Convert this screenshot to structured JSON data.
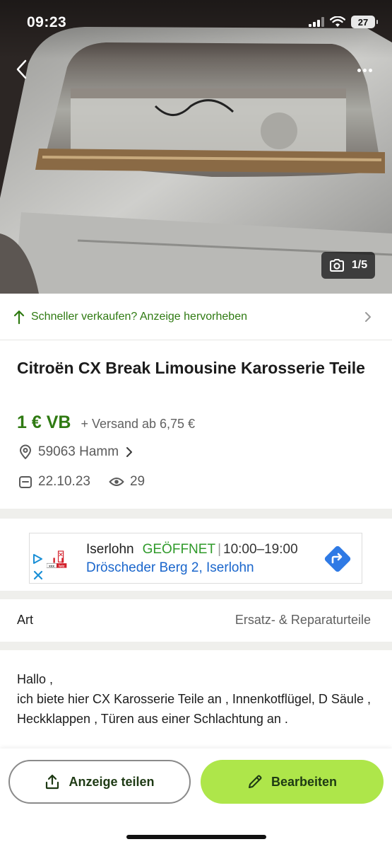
{
  "status_bar": {
    "time": "09:23",
    "battery": "27"
  },
  "gallery": {
    "counter": "1/5"
  },
  "promote": {
    "text": "Schneller verkaufen? Anzeige hervorheben"
  },
  "listing": {
    "title": "Citroën CX Break Limousine Karosserie Teile",
    "price": "1 € VB",
    "shipping": "+ Versand ab 6,75 €",
    "location": "59063 Hamm",
    "date": "22.10.23",
    "views": "29"
  },
  "ad": {
    "logo_text": "xxxlutz",
    "city": "Iserlohn",
    "status": "GEÖFFNET",
    "separator": "|",
    "hours": "10:00–19:00",
    "address": "Dröscheder Berg 2, Iserlohn"
  },
  "attributes": [
    {
      "label": "Art",
      "value": "Ersatz- & Reparaturteile"
    }
  ],
  "description": "Hallo ,\nich biete hier CX Karosserie Teile an , Innenkotflügel, D Säule , Heckklappen , Türen aus einer Schlachtung an .",
  "actions": {
    "share_label": "Anzeige teilen",
    "edit_label": "Bearbeiten"
  },
  "colors": {
    "brand_green": "#2f7a12",
    "accent_lime": "#aee64a",
    "link_blue": "#1a66cc"
  }
}
